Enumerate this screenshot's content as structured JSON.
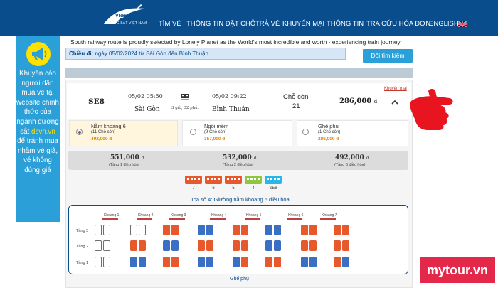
{
  "header": {
    "logo_caption": "ĐƯỜNG SẮT VIỆT NAM",
    "nav": [
      {
        "label": "TÌM VÉ"
      },
      {
        "label": "THÔNG TIN ĐẶT CHỖ"
      },
      {
        "label": "TRẢ VÉ"
      },
      {
        "label": "KHUYẾN MẠI"
      },
      {
        "label": "THÔNG TIN"
      },
      {
        "label": "TRA CỨU HÓA ĐƠN"
      },
      {
        "label": "ENGLISH"
      }
    ],
    "colors": {
      "bar": "#0a4d8c"
    }
  },
  "banner": {
    "line1": "Khuyến cáo người dân mua vé tại website chính thức của ngành đường sắt",
    "site": "dsvn.vn",
    "line2": "để tránh mua nhầm vé giả, vé không đúng giá",
    "color": "#2a9fd8",
    "icon": "megaphone-icon"
  },
  "tagline": "South railway route is proudly selected by Lonely Planet as the World's most incredible and worth - experiencing train journey",
  "route": {
    "label": "Chiều đi:",
    "text": "ngày 05/02/2024 từ Sài Gòn đến Bình Thuận",
    "search_button": "Đổi tìm kiếm"
  },
  "train": {
    "code": "SE8",
    "depart_time": "05/02 05:50",
    "depart_station": "Sài Gòn",
    "duration": "3 giờ, 32 phút",
    "arrive_time": "05/02 09:22",
    "arrive_station": "Bình Thuận",
    "seats_label": "Chỗ còn",
    "seats_left": "21",
    "price": "286,000",
    "currency": "đ",
    "promo_link": "Khuyến mại"
  },
  "options": [
    {
      "name": "Nằm khoang 6",
      "sub": "(11 Chỗ còn)",
      "price": "492,000 đ",
      "selected": true
    },
    {
      "name": "Ngồi mềm",
      "sub": "(9 Chỗ còn)",
      "price": "357,000 đ",
      "selected": false
    },
    {
      "name": "Ghế phụ",
      "sub": "(1 Chỗ còn)",
      "price": "286,000 đ",
      "selected": false
    }
  ],
  "tiers": [
    {
      "price": "551,000",
      "unit": "đ",
      "label": "(Tầng 1 điều hòa)"
    },
    {
      "price": "532,000",
      "unit": "đ",
      "label": "(Tầng 2 điều hòa)"
    },
    {
      "price": "492,000",
      "unit": "đ",
      "label": "(Tầng 3 điều hòa)"
    }
  ],
  "cars": [
    {
      "num": "7",
      "color": "#e8582d"
    },
    {
      "num": "6",
      "color": "#e8582d"
    },
    {
      "num": "5",
      "color": "#e8582d"
    },
    {
      "num": "4",
      "color": "#8dc63f"
    },
    {
      "num": "SE8",
      "color": "#29b6e8"
    }
  ],
  "coach_title": "Toa số 4: Giường nằm khoang 6 điều hòa",
  "compartments": [
    "Khoang 1",
    "Khoang 2",
    "Khoang 3",
    "Khoang 4",
    "Khoang 5",
    "Khoang 6",
    "Khoang 7"
  ],
  "tier_rows": [
    "Tầng 3",
    "Tầng 2",
    "Tầng 1"
  ],
  "seat_layout": [
    [
      "E",
      "E",
      "E",
      "E",
      "S",
      "S",
      "A",
      "A",
      "S",
      "S",
      "A",
      "A",
      "S",
      "S",
      "S",
      "S"
    ],
    [
      "E",
      "E",
      "S",
      "S",
      "A",
      "A",
      "S",
      "S",
      "S",
      "S",
      "A",
      "A",
      "S",
      "S",
      "S",
      "S"
    ],
    [
      "E",
      "E",
      "A",
      "A",
      "S",
      "S",
      "A",
      "A",
      "A",
      "S",
      "S",
      "S",
      "A",
      "A",
      "S",
      "A"
    ]
  ],
  "ghe_phu_label": "Ghế phụ",
  "watermark": "mytour.vn"
}
